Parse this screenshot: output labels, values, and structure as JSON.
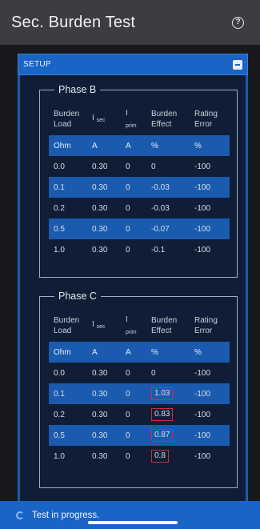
{
  "header": {
    "title": "Sec. Burden Test",
    "help_icon": "question-circle-icon"
  },
  "setup": {
    "label": "SETUP",
    "toggle_icon": "collapse-icon"
  },
  "phases": [
    {
      "title": "Phase B",
      "columns": [
        {
          "line1": "Burden",
          "line2": "Load"
        },
        {
          "main": "I",
          "sub": "sec"
        },
        {
          "main": "I",
          "sub": "prim"
        },
        {
          "line1": "Burden",
          "line2": "Effect"
        },
        {
          "line1": "Rating",
          "line2": "Error"
        }
      ],
      "units": [
        "Ohm",
        "A",
        "A",
        "%",
        "%"
      ],
      "rows": [
        [
          "0.0",
          "0.30",
          "0",
          "0",
          "-100"
        ],
        [
          "0.1",
          "0.30",
          "0",
          "-0.03",
          "-100"
        ],
        [
          "0.2",
          "0.30",
          "0",
          "-0.03",
          "-100"
        ],
        [
          "0.5",
          "0.30",
          "0",
          "-0.07",
          "-100"
        ],
        [
          "1.0",
          "0.30",
          "0",
          "-0.1",
          "-100"
        ]
      ]
    },
    {
      "title": "Phase C",
      "columns": [
        {
          "line1": "Burden",
          "line2": "Load"
        },
        {
          "main": "I",
          "sub": "sec"
        },
        {
          "main": "I",
          "sub": "prim"
        },
        {
          "line1": "Burden",
          "line2": "Effect"
        },
        {
          "line1": "Rating",
          "line2": "Error"
        }
      ],
      "units": [
        "Ohm",
        "A",
        "A",
        "%",
        "%"
      ],
      "rows": [
        [
          "0.0",
          "0.30",
          "0",
          "0",
          "-100"
        ],
        [
          "0.1",
          "0.30",
          "0",
          "1.03",
          "-100"
        ],
        [
          "0.2",
          "0.30",
          "0",
          "0.83",
          "-100"
        ],
        [
          "0.5",
          "0.30",
          "0",
          "0.87",
          "-100"
        ],
        [
          "1.0",
          "0.30",
          "0",
          "0.8",
          "-100"
        ]
      ]
    }
  ],
  "status": {
    "text": "Test in progress.",
    "icon": "spinner-icon"
  },
  "colors": {
    "accent": "#1a64c6",
    "highlight_box": "#d02a3a",
    "panel": "#0f1e36"
  }
}
